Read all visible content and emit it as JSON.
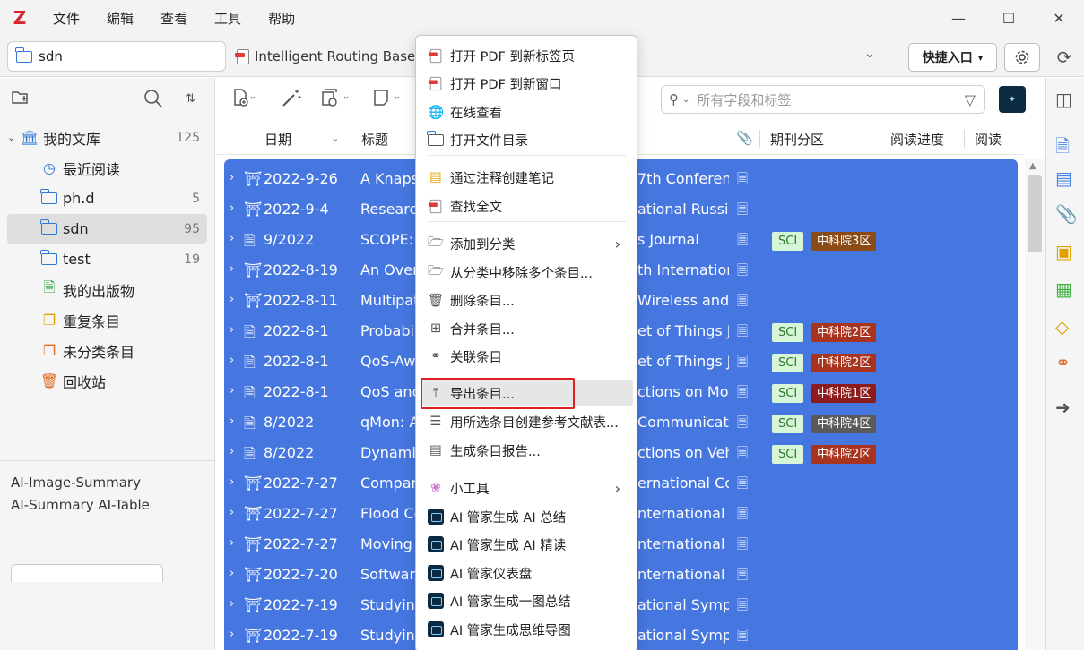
{
  "menubar": {
    "logo": "Z",
    "items": [
      "文件",
      "编辑",
      "查看",
      "工具",
      "帮助"
    ],
    "minimize": "—",
    "maximize": "☐",
    "close": "✕"
  },
  "tabs": {
    "active_label": "sdn",
    "doc_label": "Intelligent Routing Base"
  },
  "toolbar": {
    "quick_label": "快捷入口",
    "quick_caret": "▾",
    "search_placeholder": "所有字段和标签"
  },
  "library": {
    "root_label": "我的文库",
    "root_count": "125",
    "items": [
      {
        "label": "最近阅读",
        "count": ""
      },
      {
        "label": "ph.d",
        "count": "5"
      },
      {
        "label": "sdn",
        "count": "95"
      },
      {
        "label": "test",
        "count": "19"
      },
      {
        "label": "我的出版物",
        "count": ""
      },
      {
        "label": "重复条目",
        "count": ""
      },
      {
        "label": "未分类条目",
        "count": ""
      },
      {
        "label": "回收站",
        "count": ""
      }
    ],
    "tags_line1": "AI-Image-Summary",
    "tags_line2": "AI-Summary  AI-Table"
  },
  "columns": {
    "date": "日期",
    "title": "标题",
    "zone": "期刊分区",
    "progress": "阅读进度",
    "read": "阅读"
  },
  "rows": [
    {
      "icon": "conference",
      "date": "2022-9-26",
      "title": "A Knaps",
      "pub": "7th Conferen",
      "sci": "",
      "zone": "",
      "zone_color": ""
    },
    {
      "icon": "conference",
      "date": "2022-9-4",
      "title": "Research",
      "pub": "ational Russia",
      "sci": "",
      "zone": "",
      "zone_color": ""
    },
    {
      "icon": "article",
      "date": "9/2022",
      "title": "SCOPE: ",
      "pub": "s Journal",
      "sci": "SCI",
      "zone": "中科院3区",
      "zone_color": "#8a4b16"
    },
    {
      "icon": "conference",
      "date": "2022-8-19",
      "title": "An Over",
      "pub": "th Internation",
      "sci": "",
      "zone": "",
      "zone_color": ""
    },
    {
      "icon": "conference",
      "date": "2022-8-11",
      "title": "Multipat",
      "pub": "Wireless and C",
      "sci": "",
      "zone": "",
      "zone_color": ""
    },
    {
      "icon": "article",
      "date": "2022-8-1",
      "title": "Probabil",
      "pub": "et of Things Jo",
      "sci": "SCI",
      "zone": "中科院2区",
      "zone_color": "#a8341f"
    },
    {
      "icon": "article",
      "date": "2022-8-1",
      "title": "QoS-Aw",
      "pub": "et of Things Jo",
      "sci": "SCI",
      "zone": "中科院2区",
      "zone_color": "#a8341f"
    },
    {
      "icon": "article",
      "date": "2022-8-1",
      "title": "QoS and",
      "pub": "ctions on Mol",
      "sci": "SCI",
      "zone": "中科院1区",
      "zone_color": "#8e1b1b"
    },
    {
      "icon": "article",
      "date": "8/2022",
      "title": "qMon: A",
      "pub": "Communicatio",
      "sci": "SCI",
      "zone": "中科院4区",
      "zone_color": "#5a5a5a"
    },
    {
      "icon": "article",
      "date": "8/2022",
      "title": "Dynami",
      "pub": "ctions on Veh",
      "sci": "SCI",
      "zone": "中科院2区",
      "zone_color": "#a8341f"
    },
    {
      "icon": "conference",
      "date": "2022-7-27",
      "title": "Compar",
      "pub": "ernational Co",
      "sci": "",
      "zone": "",
      "zone_color": ""
    },
    {
      "icon": "conference",
      "date": "2022-7-27",
      "title": "Flood Co",
      "pub": "nternational C",
      "sci": "",
      "zone": "",
      "zone_color": ""
    },
    {
      "icon": "conference",
      "date": "2022-7-27",
      "title": "Moving",
      "pub": "nternational C",
      "sci": "",
      "zone": "",
      "zone_color": ""
    },
    {
      "icon": "conference",
      "date": "2022-7-20",
      "title": "Software",
      "pub": "nternational S",
      "sci": "",
      "zone": "",
      "zone_color": ""
    },
    {
      "icon": "conference",
      "date": "2022-7-19",
      "title": "Studying",
      "pub": "ational Sympo",
      "sci": "",
      "zone": "",
      "zone_color": ""
    },
    {
      "icon": "conference",
      "date": "2022-7-19",
      "title": "Studying",
      "pub": "ational Sympo",
      "sci": "",
      "zone": "",
      "zone_color": ""
    }
  ],
  "context_menu": {
    "items": [
      {
        "label": "打开 PDF 到新标签页",
        "icon": "pdf"
      },
      {
        "label": "打开 PDF 到新窗口",
        "icon": "pdf"
      },
      {
        "label": "在线查看",
        "icon": "globe"
      },
      {
        "label": "打开文件目录",
        "icon": "folder-open"
      },
      {
        "label": "通过注释创建笔记",
        "icon": "note"
      },
      {
        "label": "查找全文",
        "icon": "pdf"
      },
      {
        "label": "添加到分类",
        "icon": "folder-add"
      },
      {
        "label": "从分类中移除多个条目...",
        "icon": "folder-remove"
      },
      {
        "label": "删除条目...",
        "icon": "trash"
      },
      {
        "label": "合并条目...",
        "icon": "merge"
      },
      {
        "label": "关联条目",
        "icon": "link"
      },
      {
        "label": "导出条目...",
        "icon": "export"
      },
      {
        "label": "用所选条目创建参考文献表...",
        "icon": "list"
      },
      {
        "label": "生成条目报告...",
        "icon": "report"
      },
      {
        "label": "小工具",
        "icon": "gear-flower"
      },
      {
        "label": "AI 管家生成 AI 总结",
        "icon": "ai"
      },
      {
        "label": "AI 管家生成 AI 精读",
        "icon": "ai"
      },
      {
        "label": "AI 管家仪表盘",
        "icon": "ai"
      },
      {
        "label": "AI 管家生成一图总结",
        "icon": "ai"
      },
      {
        "label": "AI 管家生成思维导图",
        "icon": "ai"
      }
    ]
  }
}
